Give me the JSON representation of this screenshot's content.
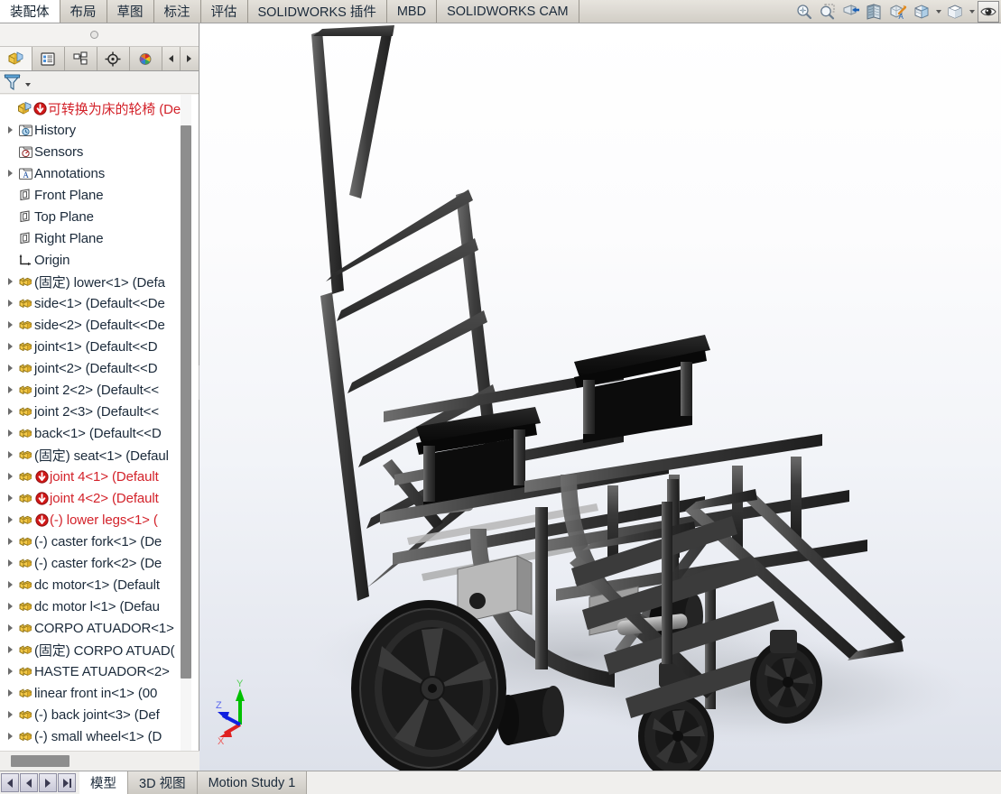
{
  "ribbon": {
    "tabs": [
      {
        "label": "装配体",
        "active": true
      },
      {
        "label": "布局",
        "active": false
      },
      {
        "label": "草图",
        "active": false
      },
      {
        "label": "标注",
        "active": false
      },
      {
        "label": "评估",
        "active": false
      },
      {
        "label": "SOLIDWORKS 插件",
        "active": false
      },
      {
        "label": "MBD",
        "active": false
      },
      {
        "label": "SOLIDWORKS CAM",
        "active": false
      }
    ],
    "icons": [
      {
        "name": "zoom-to-fit-icon"
      },
      {
        "name": "zoom-to-area-icon"
      },
      {
        "name": "zoom-in-out-icon"
      },
      {
        "name": "section-view-icon"
      },
      {
        "name": "view-orientation-icon"
      },
      {
        "name": "display-style-icon"
      },
      {
        "name": "apply-scene-icon"
      },
      {
        "name": "hide-show-items-icon"
      }
    ]
  },
  "left_panel": {
    "tabs": [
      {
        "name": "feature-manager-design-tree-tab",
        "icon": "yellow-box-icon",
        "active": true
      },
      {
        "name": "property-manager-tab",
        "icon": "property-list-icon",
        "active": false
      },
      {
        "name": "configuration-manager-tab",
        "icon": "configuration-icon",
        "active": false
      },
      {
        "name": "dimxpert-manager-tab",
        "icon": "crosshair-icon",
        "active": false
      },
      {
        "name": "display-manager-tab",
        "icon": "color-sphere-icon",
        "active": false
      }
    ],
    "nav": {
      "prev": "◀",
      "next": "▶"
    },
    "filter": {
      "name": "filter-icon",
      "label": ""
    }
  },
  "tree": {
    "items": [
      {
        "label": "可转换为床的轮椅  (Def",
        "indent": 0,
        "twisty": false,
        "icon": "assembly-icon",
        "error": true,
        "red": true
      },
      {
        "label": "History",
        "indent": 1,
        "twisty": true,
        "icon": "history-icon",
        "error": false,
        "red": false
      },
      {
        "label": "Sensors",
        "indent": 1,
        "twisty": false,
        "icon": "sensors-icon",
        "error": false,
        "red": false
      },
      {
        "label": "Annotations",
        "indent": 1,
        "twisty": true,
        "icon": "annotations-icon",
        "error": false,
        "red": false
      },
      {
        "label": "Front Plane",
        "indent": 1,
        "twisty": false,
        "icon": "plane-icon",
        "error": false,
        "red": false
      },
      {
        "label": "Top Plane",
        "indent": 1,
        "twisty": false,
        "icon": "plane-icon",
        "error": false,
        "red": false
      },
      {
        "label": "Right Plane",
        "indent": 1,
        "twisty": false,
        "icon": "plane-icon",
        "error": false,
        "red": false
      },
      {
        "label": "Origin",
        "indent": 1,
        "twisty": false,
        "icon": "origin-icon",
        "error": false,
        "red": false
      },
      {
        "label": "(固定) lower<1> (Defa",
        "indent": 1,
        "twisty": true,
        "icon": "part-icon",
        "error": false,
        "red": false
      },
      {
        "label": "side<1> (Default<<De",
        "indent": 1,
        "twisty": true,
        "icon": "part-icon",
        "error": false,
        "red": false
      },
      {
        "label": "side<2> (Default<<De",
        "indent": 1,
        "twisty": true,
        "icon": "part-icon",
        "error": false,
        "red": false
      },
      {
        "label": "joint<1> (Default<<D",
        "indent": 1,
        "twisty": true,
        "icon": "part-icon",
        "error": false,
        "red": false
      },
      {
        "label": "joint<2> (Default<<D",
        "indent": 1,
        "twisty": true,
        "icon": "part-icon",
        "error": false,
        "red": false
      },
      {
        "label": "joint 2<2> (Default<<",
        "indent": 1,
        "twisty": true,
        "icon": "part-icon",
        "error": false,
        "red": false
      },
      {
        "label": "joint 2<3> (Default<<",
        "indent": 1,
        "twisty": true,
        "icon": "part-icon",
        "error": false,
        "red": false
      },
      {
        "label": "back<1> (Default<<D",
        "indent": 1,
        "twisty": true,
        "icon": "part-icon",
        "error": false,
        "red": false
      },
      {
        "label": "(固定) seat<1> (Defaul",
        "indent": 1,
        "twisty": true,
        "icon": "part-icon",
        "error": false,
        "red": false
      },
      {
        "label": "joint 4<1> (Default",
        "indent": 1,
        "twisty": true,
        "icon": "part-icon",
        "error": true,
        "red": true
      },
      {
        "label": "joint 4<2> (Default",
        "indent": 1,
        "twisty": true,
        "icon": "part-icon",
        "error": true,
        "red": true
      },
      {
        "label": "(-) lower legs<1>  (",
        "indent": 1,
        "twisty": true,
        "icon": "part-icon",
        "error": true,
        "red": true
      },
      {
        "label": "(-) caster fork<1> (De",
        "indent": 1,
        "twisty": true,
        "icon": "part-icon",
        "error": false,
        "red": false
      },
      {
        "label": "(-) caster fork<2> (De",
        "indent": 1,
        "twisty": true,
        "icon": "part-icon",
        "error": false,
        "red": false
      },
      {
        "label": "dc motor<1> (Default",
        "indent": 1,
        "twisty": true,
        "icon": "part-icon",
        "error": false,
        "red": false
      },
      {
        "label": "dc motor l<1> (Defau",
        "indent": 1,
        "twisty": true,
        "icon": "part-icon",
        "error": false,
        "red": false
      },
      {
        "label": "CORPO ATUADOR<1>",
        "indent": 1,
        "twisty": true,
        "icon": "part-icon",
        "error": false,
        "red": false
      },
      {
        "label": "(固定) CORPO ATUAD(",
        "indent": 1,
        "twisty": true,
        "icon": "part-icon",
        "error": false,
        "red": false
      },
      {
        "label": "HASTE ATUADOR<2>",
        "indent": 1,
        "twisty": true,
        "icon": "part-icon",
        "error": false,
        "red": false
      },
      {
        "label": "linear front in<1>  (00",
        "indent": 1,
        "twisty": true,
        "icon": "part-icon",
        "error": false,
        "red": false
      },
      {
        "label": "(-) back joint<3> (Def",
        "indent": 1,
        "twisty": true,
        "icon": "part-icon",
        "error": false,
        "red": false
      },
      {
        "label": "(-) small wheel<1> (D",
        "indent": 1,
        "twisty": true,
        "icon": "part-icon",
        "error": false,
        "red": false
      }
    ]
  },
  "viewport": {
    "triad": {
      "x_label": "X",
      "y_label": "Y",
      "z_label": "Z",
      "x_color": "#e02020",
      "y_color": "#00c000",
      "z_color": "#1020e0"
    },
    "model_name": "convertible-wheelchair-bed-assembly",
    "background_top": "#ffffff",
    "background_bottom": "#dde1ea"
  },
  "bottom": {
    "nav_buttons": [
      {
        "name": "first-tab-button",
        "glyph": "first"
      },
      {
        "name": "prev-tab-button",
        "glyph": "prev"
      },
      {
        "name": "next-tab-button",
        "glyph": "next"
      },
      {
        "name": "last-tab-button",
        "glyph": "last"
      }
    ],
    "tabs": [
      {
        "label": "模型",
        "active": true
      },
      {
        "label": "3D 视图",
        "active": false
      },
      {
        "label": "Motion Study 1",
        "active": false
      }
    ]
  }
}
